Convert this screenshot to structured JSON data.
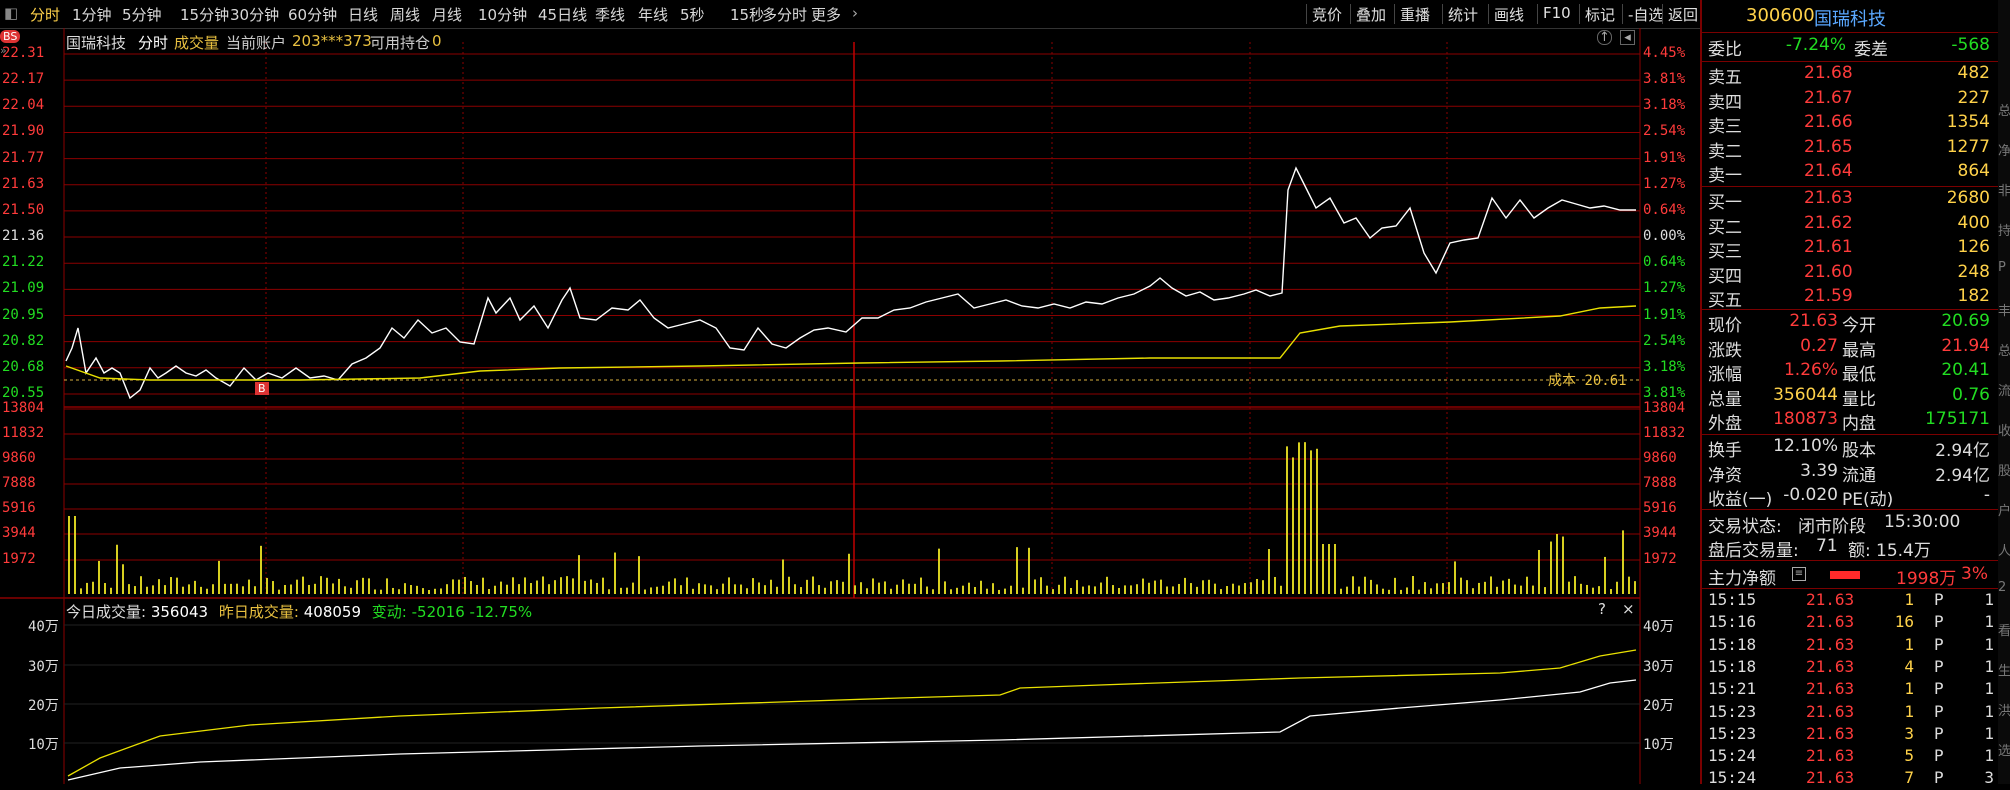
{
  "toolbar": {
    "tabs": [
      "分时",
      "1分钟",
      "5分钟",
      "15分钟",
      "30分钟",
      "60分钟",
      "日线",
      "周线",
      "月线",
      "10分钟",
      "45日线",
      "季线",
      "年线",
      "5秒",
      "15秒",
      "多分时",
      "更多"
    ],
    "right_buttons": [
      "竞价",
      "叠加",
      "重播",
      "统计",
      "画线",
      "F10",
      "标记",
      "-自选",
      "返回"
    ]
  },
  "chart_header": {
    "stock_name": "国瑞科技",
    "mode": "分时",
    "volume_label": "成交量",
    "account_label": "当前账户",
    "account_id": "203***373",
    "hold_label": "可用持仓",
    "hold_value": "0",
    "bs_badge": "BS"
  },
  "price_axis": {
    "left": [
      "22.31",
      "22.17",
      "22.04",
      "21.90",
      "21.77",
      "21.63",
      "21.50",
      "21.36",
      "21.22",
      "21.09",
      "20.95",
      "20.82",
      "20.68",
      "20.55"
    ],
    "right": [
      "4.45%",
      "3.81%",
      "3.18%",
      "2.54%",
      "1.91%",
      "1.27%",
      "0.64%",
      "0.00%",
      "0.64%",
      "1.27%",
      "1.91%",
      "2.54%",
      "3.18%",
      "3.81%"
    ]
  },
  "cost_line": {
    "label": "成本",
    "value": "20.61"
  },
  "buy_marker": "B",
  "volume_axis": [
    "13804",
    "11832",
    "9860",
    "7888",
    "5916",
    "3944",
    "1972"
  ],
  "cum_header": {
    "today_label": "今日成交量:",
    "today_value": "356043",
    "yesterday_label": "昨日成交量:",
    "yesterday_value": "408059",
    "change_label": "变动:",
    "change_value": "-52016",
    "change_pct": "-12.75%",
    "help": "?",
    "close": "×"
  },
  "cum_axis": [
    "40万",
    "30万",
    "20万",
    "10万"
  ],
  "colors": {
    "up": "#ff3b3b",
    "down": "#22dd22",
    "grid": "#8b0000",
    "avg": "#e8e000",
    "price": "#ffffff",
    "label": "#e8c040"
  },
  "panel": {
    "code": "300600",
    "name": "国瑞科技",
    "weibi_label": "委比",
    "weibi": "-7.24%",
    "weicha_label": "委差",
    "weicha": "-568",
    "asks": [
      {
        "label": "卖五",
        "price": "21.68",
        "vol": "482"
      },
      {
        "label": "卖四",
        "price": "21.67",
        "vol": "227"
      },
      {
        "label": "卖三",
        "price": "21.66",
        "vol": "1354"
      },
      {
        "label": "卖二",
        "price": "21.65",
        "vol": "1277"
      },
      {
        "label": "卖一",
        "price": "21.64",
        "vol": "864"
      }
    ],
    "bids": [
      {
        "label": "买一",
        "price": "21.63",
        "vol": "2680"
      },
      {
        "label": "买二",
        "price": "21.62",
        "vol": "400"
      },
      {
        "label": "买三",
        "price": "21.61",
        "vol": "126"
      },
      {
        "label": "买四",
        "price": "21.60",
        "vol": "248"
      },
      {
        "label": "买五",
        "price": "21.59",
        "vol": "182"
      }
    ],
    "quote": [
      {
        "l1": "现价",
        "v1": "21.63",
        "l2": "今开",
        "v2": "20.69",
        "c1": "up",
        "c2": "down"
      },
      {
        "l1": "涨跌",
        "v1": "0.27",
        "l2": "最高",
        "v2": "21.94",
        "c1": "up",
        "c2": "up"
      },
      {
        "l1": "涨幅",
        "v1": "1.26%",
        "l2": "最低",
        "v2": "20.41",
        "c1": "up",
        "c2": "down"
      },
      {
        "l1": "总量",
        "v1": "356044",
        "l2": "量比",
        "v2": "0.76",
        "c1": "yellow",
        "c2": "down"
      },
      {
        "l1": "外盘",
        "v1": "180873",
        "l2": "内盘",
        "v2": "175171",
        "c1": "up",
        "c2": "down"
      }
    ],
    "fund": [
      {
        "l1": "换手",
        "v1": "12.10%",
        "l2": "股本",
        "v2": "2.94亿"
      },
      {
        "l1": "净资",
        "v1": "3.39",
        "l2": "流通",
        "v2": "2.94亿"
      },
      {
        "l1": "收益(一)",
        "v1": "-0.020",
        "l2": "PE(动)",
        "v2": "-"
      }
    ],
    "trade_status_label": "交易状态:",
    "trade_status": "闭市阶段",
    "trade_time": "15:30:00",
    "after_label": "盘后交易量:",
    "after_vol": "71",
    "after_amt_label": "额:",
    "after_amt": "15.4万",
    "main_flow_label": "主力净额",
    "main_flow": "1998万",
    "main_flow_pct": "3%",
    "ticks": [
      {
        "time": "15:15",
        "price": "21.63",
        "vol": "1",
        "flag": "P",
        "n": "1"
      },
      {
        "time": "15:16",
        "price": "21.63",
        "vol": "16",
        "flag": "P",
        "n": "1"
      },
      {
        "time": "15:18",
        "price": "21.63",
        "vol": "1",
        "flag": "P",
        "n": "1"
      },
      {
        "time": "15:18",
        "price": "21.63",
        "vol": "4",
        "flag": "P",
        "n": "1"
      },
      {
        "time": "15:21",
        "price": "21.63",
        "vol": "1",
        "flag": "P",
        "n": "1"
      },
      {
        "time": "15:23",
        "price": "21.63",
        "vol": "1",
        "flag": "P",
        "n": "1"
      },
      {
        "time": "15:23",
        "price": "21.63",
        "vol": "3",
        "flag": "P",
        "n": "1"
      },
      {
        "time": "15:24",
        "price": "21.63",
        "vol": "5",
        "flag": "P",
        "n": "1"
      },
      {
        "time": "15:24",
        "price": "21.63",
        "vol": "7",
        "flag": "P",
        "n": "3"
      }
    ]
  },
  "edge_chars": [
    "总",
    "净",
    "非",
    "持",
    "P",
    "丰",
    "总",
    "流",
    "收",
    "股",
    "户",
    "人",
    "2",
    "看",
    "生",
    "洪",
    "选"
  ]
}
